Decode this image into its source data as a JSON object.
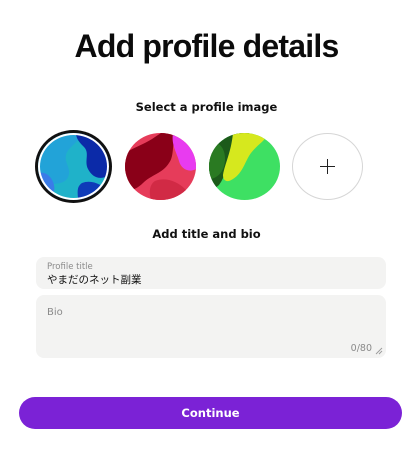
{
  "header": {
    "title": "Add profile details"
  },
  "profile_image": {
    "label": "Select a profile image",
    "options": [
      {
        "name": "avatar-blue",
        "selected": true,
        "colors": [
          "#0b2aa8",
          "#1fb2c9",
          "#3a7ce8"
        ]
      },
      {
        "name": "avatar-red-magenta",
        "selected": false,
        "colors": [
          "#8a0018",
          "#e63c5a",
          "#e83bf0"
        ]
      },
      {
        "name": "avatar-green-yellow",
        "selected": false,
        "colors": [
          "#1c5a1a",
          "#d6e81e",
          "#3ee063"
        ]
      }
    ],
    "add_icon": "plus-icon"
  },
  "bio_section": {
    "label": "Add title and bio",
    "title_field": {
      "label": "Profile title",
      "value": "やまだのネット副業"
    },
    "bio_field": {
      "placeholder": "Bio",
      "counter": "0/80"
    }
  },
  "actions": {
    "continue_label": "Continue"
  },
  "colors": {
    "accent": "#7b22d6",
    "field_bg": "#f3f3f2"
  }
}
